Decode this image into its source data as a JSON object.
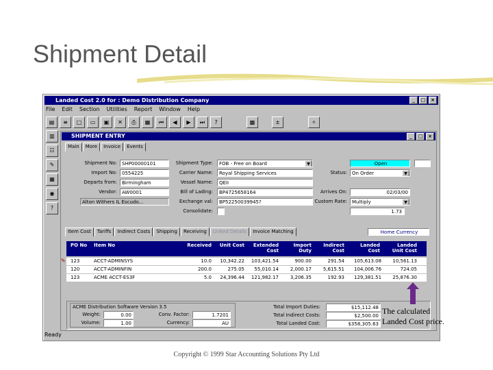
{
  "slide": {
    "title": "Shipment Detail",
    "copyright": "Copyright © 1999 Star Accounting Solutions Pty Ltd",
    "note": "The calculated Landed Cost price."
  },
  "app": {
    "title": "Landed Cost 2.0 for : Demo Distribution Company",
    "menu": [
      "File",
      "Edit",
      "Section",
      "Utilities",
      "Report",
      "Window",
      "Help"
    ],
    "status": "Ready"
  },
  "toolbar_icons": [
    "browse-icon",
    "list-icon",
    "new-icon",
    "open-icon",
    "save-icon",
    "delete-icon",
    "print-icon",
    "preview-icon",
    "first-record-icon",
    "prev-record-icon",
    "next-record-icon",
    "last-record-icon",
    "help-icon",
    "calculator-icon",
    "wizard-icon",
    "tools-icon"
  ],
  "sidebar_icons": [
    "shipments-icon",
    "vendors-icon",
    "items-icon",
    "reports-icon",
    "settings-icon",
    "help-icon"
  ],
  "shipment_entry": {
    "title": "SHIPMENT ENTRY",
    "tabs": [
      "Main",
      "More",
      "Invoice",
      "Events"
    ],
    "fields": {
      "shipment_no": {
        "label": "Shipment No:",
        "value": "SHP00000101"
      },
      "import_no": {
        "label": "Import No:",
        "value": "0554225"
      },
      "departs_from": {
        "label": "Departs from:",
        "value": "Birmingham"
      },
      "vendor": {
        "label": "Vendor:",
        "value": "AW0001"
      },
      "vendor_name": {
        "value": "Alton Withers IL Escudo..."
      },
      "shipment_type": {
        "label": "Shipment Type:",
        "value": "FOB - Free on Board"
      },
      "carrier_name": {
        "label": "Carrier Name:",
        "value": "Royal Shipping Services"
      },
      "vessel_name": {
        "label": "Vessel Name:",
        "value": "QEII"
      },
      "bill_of_lading": {
        "label": "Bill of Lading:",
        "value": "BP4725658164"
      },
      "exchange_val": {
        "label": "Exchange val:",
        "value": "BP52250039945?"
      },
      "consolidate": {
        "label": "Consolidate:",
        "value": ""
      },
      "status": {
        "label": "Status:",
        "value": "Open"
      },
      "status2": {
        "value": "On Order"
      },
      "arrives_on": {
        "label": "Arrives On:",
        "value": "02/03/00"
      },
      "custom_rate": {
        "label": "Custom Rate:",
        "value": "Multiply"
      },
      "rate_value": {
        "value": "1.73"
      }
    },
    "lower_tabs": [
      "Item Cost",
      "Tariffs",
      "Indirect Costs",
      "Shipping",
      "Receiving",
      "Linked Details",
      "Invoice Matching"
    ],
    "currency_label": "Home Currency",
    "columns": [
      "PO No",
      "Item No",
      "Received",
      "Unit Cost",
      "Extended Cost",
      "Import Duty",
      "Indirect Cost",
      "Landed Cost",
      "Landed Unit Cost"
    ],
    "rows": [
      [
        "123",
        "ACCT-ADMINSYS",
        "10.0",
        "10,342.22",
        "103,421.54",
        "900.00",
        "291.54",
        "105,613.08",
        "10,561.13"
      ],
      [
        "120",
        "ACCT-ADMINFIN",
        "200.0",
        "275.05",
        "55,010.14",
        "2,000.17",
        "5,615.51",
        "104,006.76",
        "724.05"
      ],
      [
        "123",
        "ACME ACCT-ES3F",
        "5.0",
        "24,396.44",
        "121,982.17",
        "3,206.35",
        "192.93",
        "129,381.51",
        "25,876.30"
      ]
    ],
    "version_box": {
      "title": "ACME Distribution Software Version 3.5",
      "weight_label": "Weight:",
      "weight": "0.00",
      "volume_label": "Volume:",
      "volume": "1.00",
      "conv_label": "Conv. Factor:",
      "conv": "1.7201",
      "currency_label": "Currency:",
      "currency": "AU"
    },
    "totals": {
      "import_duties_label": "Total Import Duties:",
      "import_duties": "$15,112.48",
      "indirect_costs_label": "Total Indirect Costs:",
      "indirect_costs": "$2,500.00",
      "landed_cost_label": "Total Landed Cost:",
      "landed_cost": "$358,305.63"
    }
  },
  "colors": {
    "titlebar": "#000080",
    "status_open": "#00ffff",
    "window": "#c0c0c0",
    "arrow": "#6a2a8a"
  }
}
